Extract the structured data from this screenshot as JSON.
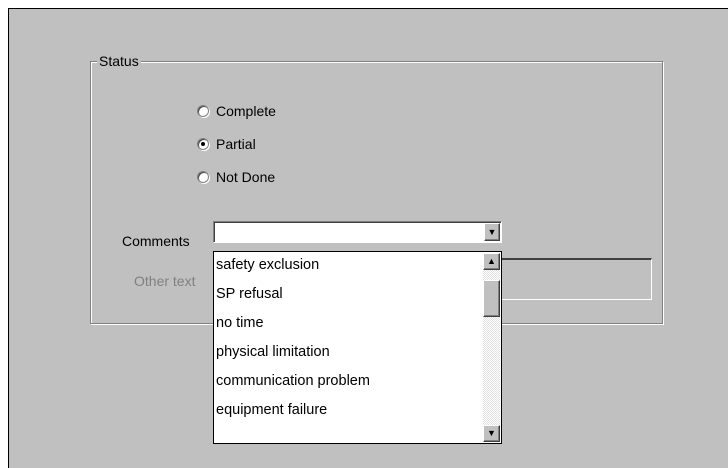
{
  "status_group": {
    "legend": "Status",
    "options": [
      {
        "label": "Complete",
        "checked": false
      },
      {
        "label": "Partial",
        "checked": true
      },
      {
        "label": "Not Done",
        "checked": false
      }
    ]
  },
  "comments": {
    "label": "Comments",
    "value": "",
    "options": [
      "safety exclusion",
      "SP refusal",
      "no time",
      "physical limitation",
      "communication problem",
      "equipment failure"
    ]
  },
  "other_text": {
    "label": "Other text",
    "enabled": false
  },
  "icons": {
    "dropdown_arrow": "▼",
    "scroll_up": "▲",
    "scroll_down": "▼"
  },
  "colors": {
    "dialog_bg": "#c0c0c0",
    "disabled_text": "#808080"
  }
}
